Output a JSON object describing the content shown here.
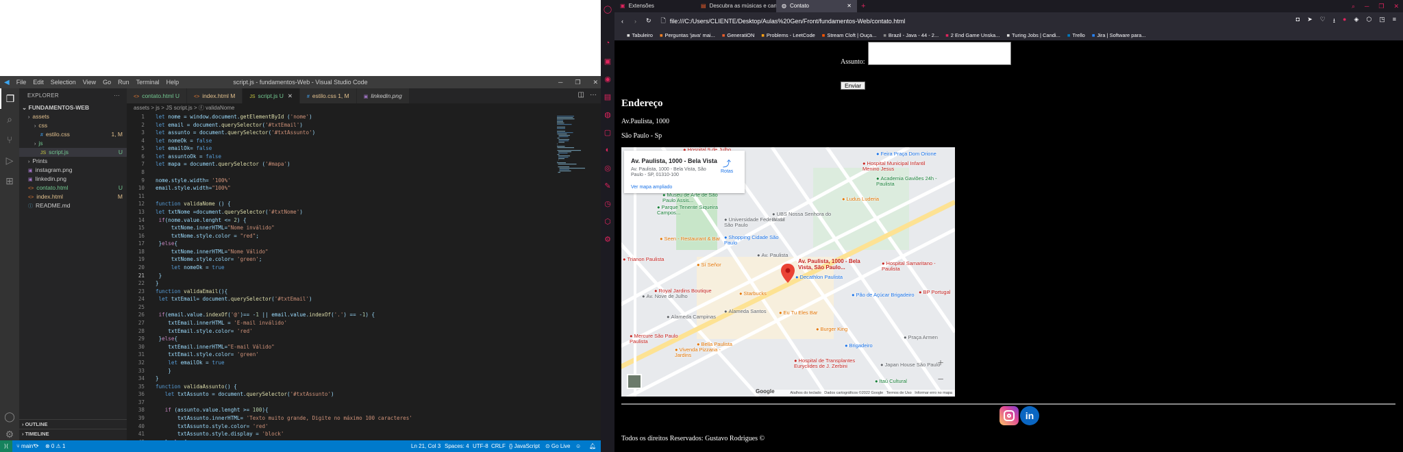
{
  "vscode": {
    "window_title": "script.js - fundamentos-Web - Visual Studio Code",
    "menu": [
      "File",
      "Edit",
      "Selection",
      "View",
      "Go",
      "Run",
      "Terminal",
      "Help"
    ],
    "explorer_title": "EXPLORER",
    "project": "FUNDAMENTOS-WEB",
    "tree": [
      {
        "label": "assets",
        "indent": 1,
        "type": "folder",
        "color": "#e2c08d",
        "badge": ""
      },
      {
        "label": "css",
        "indent": 2,
        "type": "folder",
        "color": "#e2c08d",
        "badge": ""
      },
      {
        "label": "estilo.css",
        "indent": 3,
        "type": "css",
        "color": "#e2c08d",
        "badge": "1, M"
      },
      {
        "label": "js",
        "indent": 2,
        "type": "folder",
        "color": "#73c991",
        "badge": ""
      },
      {
        "label": "script.js",
        "indent": 3,
        "type": "js",
        "color": "#73c991",
        "badge": "U"
      },
      {
        "label": "Prints",
        "indent": 1,
        "type": "folder",
        "color": "#ccc",
        "badge": ""
      },
      {
        "label": "instagram.png",
        "indent": 1,
        "type": "img",
        "color": "#ccc",
        "badge": ""
      },
      {
        "label": "linkedin.png",
        "indent": 1,
        "type": "img",
        "color": "#ccc",
        "badge": ""
      },
      {
        "label": "contato.html",
        "indent": 1,
        "type": "html",
        "color": "#73c991",
        "badge": "U"
      },
      {
        "label": "index.html",
        "indent": 1,
        "type": "html",
        "color": "#e2c08d",
        "badge": "M"
      },
      {
        "label": "README.md",
        "indent": 1,
        "type": "md",
        "color": "#ccc",
        "badge": ""
      }
    ],
    "outline": "OUTLINE",
    "timeline": "TIMELINE",
    "tabs": [
      {
        "label": "contato.html U",
        "active": false,
        "color": "#73c991"
      },
      {
        "label": "index.html M",
        "active": false,
        "color": "#e2c08d"
      },
      {
        "label": "script.js U",
        "active": true,
        "color": "#73c991"
      },
      {
        "label": "estilo.css 1, M",
        "active": false,
        "color": "#e2c08d"
      },
      {
        "label": "linkedin.png",
        "active": false,
        "color": "#ccc"
      }
    ],
    "breadcrumb": "assets > js > JS script.js > ⓕ validaNome",
    "code": [
      "let nome = window.document.getElementById ('nome')",
      "let email = document.querySelector('#txtEmail')",
      "let assunto = document.querySelector('#txtAssunto')",
      "let nomeOk = false",
      "let emailOk= false",
      "let assuntoOk = false",
      "let mapa = document.querySelector ('#mapa')",
      "",
      "nome.style.width= '100%'",
      "email.style.width=\"100%\"",
      "",
      "function validaNome () {",
      "let txtNome =document.querySelector('#txtNome')",
      " if(nome.value.lenght <= 2) {",
      "     txtNome.innerHTML=\"Nome inválido\"",
      "     txtNome.style.color = \"red\";",
      " }else{",
      "     txtNome.innerHTML=\"Nome Válido\"",
      "     txtNome.style.color= 'green';",
      "     let nomeOk = true",
      " }",
      "}",
      "function validaEmail(){",
      " let txtEmail= document.querySelector('#txtEmail')",
      "",
      " if(email.value.indexOf('@')== -1 || email.value.indexOf('.') == -1) {",
      "    txtEmail.innerHTML = 'E-mail inválido'",
      "    txtEmail.style.color= 'red'",
      " }else{",
      "    txtEmail.innerHTML=\"E-mail Válido\"",
      "    txtEmail.style.color= 'green'",
      "    let emailOk = true",
      "    }",
      "}",
      "function validaAssunto() {",
      "   let txtAssunto = document.querySelector('#txtAssunto')",
      "",
      "   if (assunto.value.lenght >= 100){",
      "       txtAssunto.innerHTML= 'Texto muito grande, Digite no máximo 100 caracteres'",
      "       txtAssunto.style.color= 'red'",
      "       txtAssunto.style.display = 'block'",
      "   } else{"
    ],
    "current_line": 21,
    "status": {
      "branch": "main*",
      "problems": "⊗ 0 ⚠ 1",
      "position": "Ln 21, Col 3",
      "spaces": "Spaces: 4",
      "encoding": "UTF-8",
      "eol": "CRLF",
      "language": "{} JavaScript",
      "golive": "⊙ Go Live"
    }
  },
  "browser": {
    "tabs": [
      {
        "label": "Extensões",
        "active": false
      },
      {
        "label": "Descubra as músicas e can",
        "active": false
      },
      {
        "label": "Contato",
        "active": true
      }
    ],
    "url": "file:///C:/Users/CLIENTE/Desktop/Aulas%20Gen/Front/fundamentos-Web/contato.html",
    "bookmarks": [
      "Tabuleiro",
      "Perguntas 'java' mai...",
      "GeneratiON",
      "Problems - LeetCode",
      "Stream Cloft | Ouça...",
      "Brazil - Java - 44 - 2...",
      "2 End Game Unska...",
      "Turing Jobs | Candi...",
      "Trello",
      "Jira | Software para..."
    ],
    "page": {
      "assunto_label": "Assunto:",
      "send_button": "Enviar",
      "address_heading": "Endereço",
      "address_line1": "Av.Paulista, 1000",
      "address_line2": "São Paulo - Sp",
      "footer": "Todos os direitos Reservados: Gustavo Rodrigues ©"
    },
    "map": {
      "card_title": "Av. Paulista, 1000 - Bela Vista",
      "card_address": "Av. Paulista, 1000 - Bela Vista, São Paulo - SP, 01310-100",
      "card_routes": "Rotas",
      "card_link": "Ver mapa ampliado",
      "pin_label": "Av. Paulista, 1000 - Bela Vista, São Paulo...",
      "attribution": "Atalhos do teclado   Dados cartográficos ©2022 Google   Termos de Uso   Informar erro no mapa",
      "google": "Google",
      "labels": [
        {
          "t": "Hospital 9 de Julho",
          "c": "#c5221f"
        },
        {
          "t": "Feira Praça Dom Orione",
          "c": "#1a73e8"
        },
        {
          "t": "Hospital Municipal Infantil Menino Jesus",
          "c": "#c5221f"
        },
        {
          "t": "Academia Gaviões 24h - Paulista",
          "c": "#188038"
        },
        {
          "t": "Museu de Arte de São Paulo Assis...",
          "c": "#188038"
        },
        {
          "t": "Parque Tenente Siqueira Campos...",
          "c": "#188038"
        },
        {
          "t": "Universidade Federal de São Paulo",
          "c": "#5f6368"
        },
        {
          "t": "UBS Nossa Senhora do Brasil",
          "c": "#5f6368"
        },
        {
          "t": "Ludus Luderia",
          "c": "#e37400"
        },
        {
          "t": "Seen - Restaurant & Bar",
          "c": "#e37400"
        },
        {
          "t": "Shopping Cidade São Paulo",
          "c": "#1a73e8"
        },
        {
          "t": "Trianon Paulista",
          "c": "#c5221f"
        },
        {
          "t": "Sí Señor",
          "c": "#e37400"
        },
        {
          "t": "Hospital Samaritano - Paulista",
          "c": "#c5221f"
        },
        {
          "t": "Decathlon Paulista",
          "c": "#1a73e8"
        },
        {
          "t": "Royal Jardins Boutique",
          "c": "#c5221f"
        },
        {
          "t": "Starbucks",
          "c": "#e37400"
        },
        {
          "t": "Pão de Açúcar Brigadeiro",
          "c": "#1a73e8"
        },
        {
          "t": "Eu Tu Eles Bar",
          "c": "#e37400"
        },
        {
          "t": "Burger King",
          "c": "#e37400"
        },
        {
          "t": "Mercure São Paulo Paulista",
          "c": "#c5221f"
        },
        {
          "t": "Bella Paulista",
          "c": "#e37400"
        },
        {
          "t": "Vivenda Pizzaria - Jardins",
          "c": "#e37400"
        },
        {
          "t": "Hospital de Transplantes Euryclides de J. Zerbini",
          "c": "#c5221f"
        },
        {
          "t": "Brigadeiro",
          "c": "#1a73e8"
        },
        {
          "t": "Japan House São Paulo",
          "c": "#5f6368"
        },
        {
          "t": "Itaú Cultural",
          "c": "#188038"
        },
        {
          "t": "Praça Armen",
          "c": "#5f6368"
        },
        {
          "t": "BP Portugal",
          "c": "#c5221f"
        },
        {
          "t": "Alameda Santos",
          "c": "#5f6368"
        },
        {
          "t": "Av. Paulista",
          "c": "#5f6368"
        },
        {
          "t": "Alameda Campinas",
          "c": "#5f6368"
        },
        {
          "t": "Av. Nove de Julho",
          "c": "#5f6368"
        }
      ]
    }
  }
}
